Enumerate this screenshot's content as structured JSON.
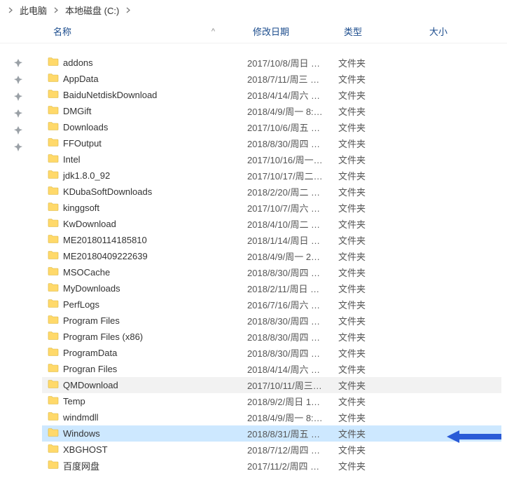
{
  "breadcrumb": {
    "items": [
      "此电脑",
      "本地磁盘 (C:)"
    ]
  },
  "columns": {
    "name": "名称",
    "date": "修改日期",
    "type": "类型",
    "size": "大小",
    "sort_indicator": "^"
  },
  "folder_type_label": "文件夹",
  "selected_index": 23,
  "hover_index": 20,
  "pins": 6,
  "files": [
    {
      "name": "addons",
      "date": "2017/10/8/周日 …",
      "type_key": "folder"
    },
    {
      "name": "AppData",
      "date": "2018/7/11/周三 …",
      "type_key": "folder"
    },
    {
      "name": "BaiduNetdiskDownload",
      "date": "2018/4/14/周六 …",
      "type_key": "folder"
    },
    {
      "name": "DMGift",
      "date": "2018/4/9/周一 8:…",
      "type_key": "folder"
    },
    {
      "name": "Downloads",
      "date": "2017/10/6/周五 …",
      "type_key": "folder"
    },
    {
      "name": "FFOutput",
      "date": "2018/8/30/周四 …",
      "type_key": "folder"
    },
    {
      "name": "Intel",
      "date": "2017/10/16/周一…",
      "type_key": "folder"
    },
    {
      "name": "jdk1.8.0_92",
      "date": "2017/10/17/周二…",
      "type_key": "folder"
    },
    {
      "name": "KDubaSoftDownloads",
      "date": "2018/2/20/周二 …",
      "type_key": "folder"
    },
    {
      "name": "kinggsoft",
      "date": "2017/10/7/周六 …",
      "type_key": "folder"
    },
    {
      "name": "KwDownload",
      "date": "2018/4/10/周二 …",
      "type_key": "folder"
    },
    {
      "name": "ME20180114185810",
      "date": "2018/1/14/周日 …",
      "type_key": "folder"
    },
    {
      "name": "ME20180409222639",
      "date": "2018/4/9/周一 2…",
      "type_key": "folder"
    },
    {
      "name": "MSOCache",
      "date": "2018/8/30/周四 …",
      "type_key": "folder"
    },
    {
      "name": "MyDownloads",
      "date": "2018/2/11/周日 …",
      "type_key": "folder"
    },
    {
      "name": "PerfLogs",
      "date": "2016/7/16/周六 …",
      "type_key": "folder"
    },
    {
      "name": "Program Files",
      "date": "2018/8/30/周四 …",
      "type_key": "folder"
    },
    {
      "name": "Program Files (x86)",
      "date": "2018/8/30/周四 …",
      "type_key": "folder"
    },
    {
      "name": "ProgramData",
      "date": "2018/8/30/周四 …",
      "type_key": "folder"
    },
    {
      "name": "Progran Files",
      "date": "2018/4/14/周六 …",
      "type_key": "folder"
    },
    {
      "name": "QMDownload",
      "date": "2017/10/11/周三…",
      "type_key": "folder"
    },
    {
      "name": "Temp",
      "date": "2018/9/2/周日 1…",
      "type_key": "folder"
    },
    {
      "name": "windmdll",
      "date": "2018/4/9/周一 8:…",
      "type_key": "folder"
    },
    {
      "name": "Windows",
      "date": "2018/8/31/周五 …",
      "type_key": "folder"
    },
    {
      "name": "XBGHOST",
      "date": "2018/7/12/周四 …",
      "type_key": "folder"
    },
    {
      "name": "百度网盘",
      "date": "2017/11/2/周四 …",
      "type_key": "folder"
    }
  ]
}
